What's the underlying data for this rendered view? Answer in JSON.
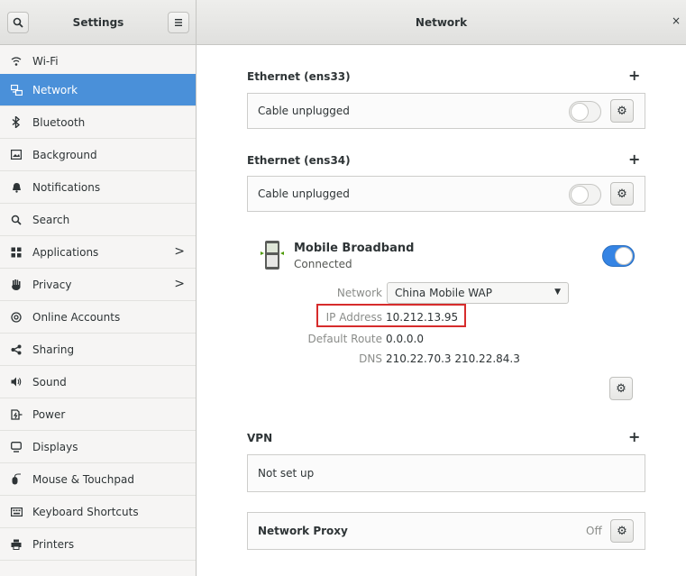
{
  "header": {
    "sidebar_title": "Settings",
    "main_title": "Network",
    "close_glyph": "×",
    "search_icon": "search-icon",
    "menu_icon": "hamburger-menu-icon"
  },
  "sidebar": {
    "items": [
      {
        "label": "Wi-Fi",
        "icon": "wifi-icon",
        "glyph": "ᯤ"
      },
      {
        "label": "Network",
        "icon": "network-icon",
        "glyph": "⊡"
      },
      {
        "label": "Bluetooth",
        "icon": "bluetooth-icon",
        "glyph": "✱"
      },
      {
        "label": "Background",
        "icon": "background-icon",
        "glyph": "▣"
      },
      {
        "label": "Notifications",
        "icon": "notifications-icon",
        "glyph": "▲"
      },
      {
        "label": "Search",
        "icon": "search-icon",
        "glyph": "⌕"
      },
      {
        "label": "Applications",
        "icon": "applications-icon",
        "glyph": "▦"
      },
      {
        "label": "Privacy",
        "icon": "privacy-icon",
        "glyph": "✋"
      },
      {
        "label": "Online Accounts",
        "icon": "online-accounts-icon",
        "glyph": "@"
      },
      {
        "label": "Sharing",
        "icon": "sharing-icon",
        "glyph": "<"
      },
      {
        "label": "Sound",
        "icon": "sound-icon",
        "glyph": "◀"
      },
      {
        "label": "Power",
        "icon": "power-icon",
        "glyph": "⌁"
      },
      {
        "label": "Displays",
        "icon": "displays-icon",
        "glyph": "▭"
      },
      {
        "label": "Mouse & Touchpad",
        "icon": "mouse-icon",
        "glyph": "✎"
      },
      {
        "label": "Keyboard Shortcuts",
        "icon": "keyboard-icon",
        "glyph": "⌨"
      },
      {
        "label": "Printers",
        "icon": "printer-icon",
        "glyph": "⎙"
      }
    ],
    "active": "Network",
    "chevron": ">"
  },
  "ethernet1": {
    "title": "Ethernet (ens33)",
    "status": "Cable unplugged",
    "enabled": false
  },
  "ethernet2": {
    "title": "Ethernet (ens34)",
    "status": "Cable unplugged",
    "enabled": false
  },
  "add_glyph": "+",
  "gear_glyph": "⚙",
  "mobile": {
    "title": "Mobile Broadband",
    "status": "Connected",
    "enabled": true,
    "network_label": "Network",
    "network_value": "China Mobile WAP",
    "ip_label": "IP Address",
    "ip_value": "10.212.13.95",
    "route_label": "Default Route",
    "route_value": "0.0.0.0",
    "dns_label": "DNS",
    "dns_value": "210.22.70.3 210.22.84.3",
    "dropdown_arrow": "▼"
  },
  "vpn": {
    "title": "VPN",
    "status": "Not set up"
  },
  "proxy": {
    "title": "Network Proxy",
    "state": "Off"
  },
  "colors": {
    "accent": "#4a90d9",
    "switch_on": "#3584e4",
    "highlight": "#d62c2c"
  }
}
